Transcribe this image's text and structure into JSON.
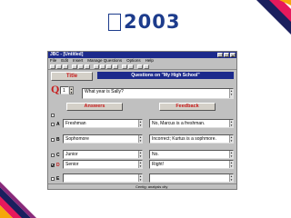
{
  "slide": {
    "title": "2003",
    "colors": {
      "title": "#1d3c8c",
      "deco_navy": "#1a1f5e",
      "deco_pink": "#e6195c",
      "deco_yellow": "#f5a80a"
    }
  },
  "app": {
    "window_title": "JBC - [Untitled]",
    "title_buttons": [
      "_",
      "□",
      "×"
    ],
    "menu": [
      "File",
      "Edit",
      "Insert",
      "Manage Questions",
      "Options",
      "Help"
    ],
    "title_button_label": "Title",
    "question_heading": "Questions on \"My High School\"",
    "question_letter": "Q",
    "question_number": "1",
    "question_text": "What year is Sally?",
    "answers_button": "Answers",
    "feedback_button": "Feedback",
    "options": [
      {
        "letter": "A",
        "answer": "Freshman",
        "feedback": "No, Marcus is a freshman.",
        "checked": false
      },
      {
        "letter": "B",
        "answer": "Sophomore",
        "feedback": "Incorrect; Kurtus is a sophmore.",
        "checked": false
      },
      {
        "letter": "C",
        "answer": "Junior",
        "feedback": "No.",
        "checked": false
      },
      {
        "letter": "D",
        "answer": "Senior",
        "feedback": "Right!",
        "checked": true
      },
      {
        "letter": "E",
        "answer": "",
        "feedback": "",
        "checked": false
      }
    ],
    "status": "Centig: analysis city"
  }
}
